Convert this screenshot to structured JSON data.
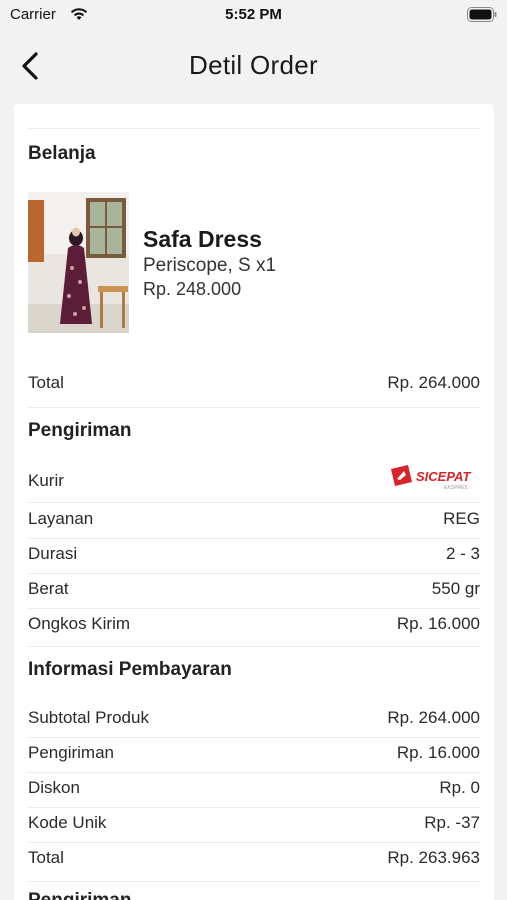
{
  "status_bar": {
    "carrier": "Carrier",
    "time": "5:52 PM"
  },
  "nav": {
    "title": "Detil Order"
  },
  "belanja": {
    "title": "Belanja",
    "product": {
      "name": "Safa Dress",
      "variant": "Periscope, S x1",
      "price": "Rp. 248.000"
    },
    "total_label": "Total",
    "total_value": "Rp. 264.000"
  },
  "pengiriman": {
    "title": "Pengiriman",
    "kurir_label": "Kurir",
    "kurir_logo_text": "SICEPAT",
    "kurir_logo_sub": "EKSPRES",
    "rows": [
      {
        "label": "Layanan",
        "value": "REG"
      },
      {
        "label": "Durasi",
        "value": "2 - 3"
      },
      {
        "label": "Berat",
        "value": "550 gr"
      },
      {
        "label": "Ongkos Kirim",
        "value": "Rp. 16.000"
      }
    ]
  },
  "pembayaran": {
    "title": "Informasi Pembayaran",
    "rows": [
      {
        "label": "Subtotal Produk",
        "value": "Rp. 264.000"
      },
      {
        "label": "Pengiriman",
        "value": "Rp. 16.000"
      },
      {
        "label": "Diskon",
        "value": "Rp. 0"
      },
      {
        "label": "Kode Unik",
        "value": "Rp. -37"
      },
      {
        "label": "Total",
        "value": "Rp. 263.963"
      }
    ]
  },
  "next_section": {
    "title": "Pengiriman"
  },
  "colors": {
    "background": "#f2f2f3",
    "card": "#ffffff",
    "brand_red": "#d8232a",
    "divider": "#ececec"
  }
}
